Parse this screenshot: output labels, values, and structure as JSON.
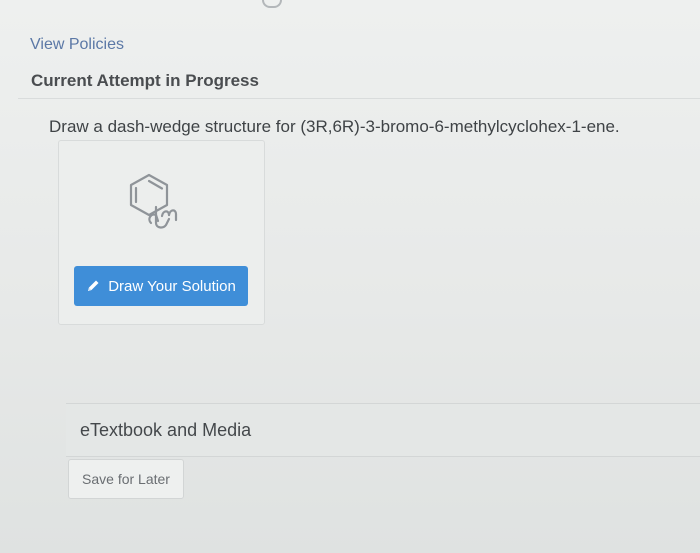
{
  "header": {
    "view_policies": "View Policies",
    "attempt_status": "Current Attempt in Progress"
  },
  "question": {
    "prompt": "Draw a dash-wedge structure for (3R,6R)-3-bromo-6-methylcyclohex-1-ene."
  },
  "drawing": {
    "button_label": "Draw Your Solution",
    "button_color": "#3f8ed8",
    "icons": [
      "molecule-hand-icon",
      "pencil-icon"
    ]
  },
  "resources": {
    "etextbook_label": "eTextbook and Media"
  },
  "actions": {
    "save_label": "Save for Later"
  }
}
